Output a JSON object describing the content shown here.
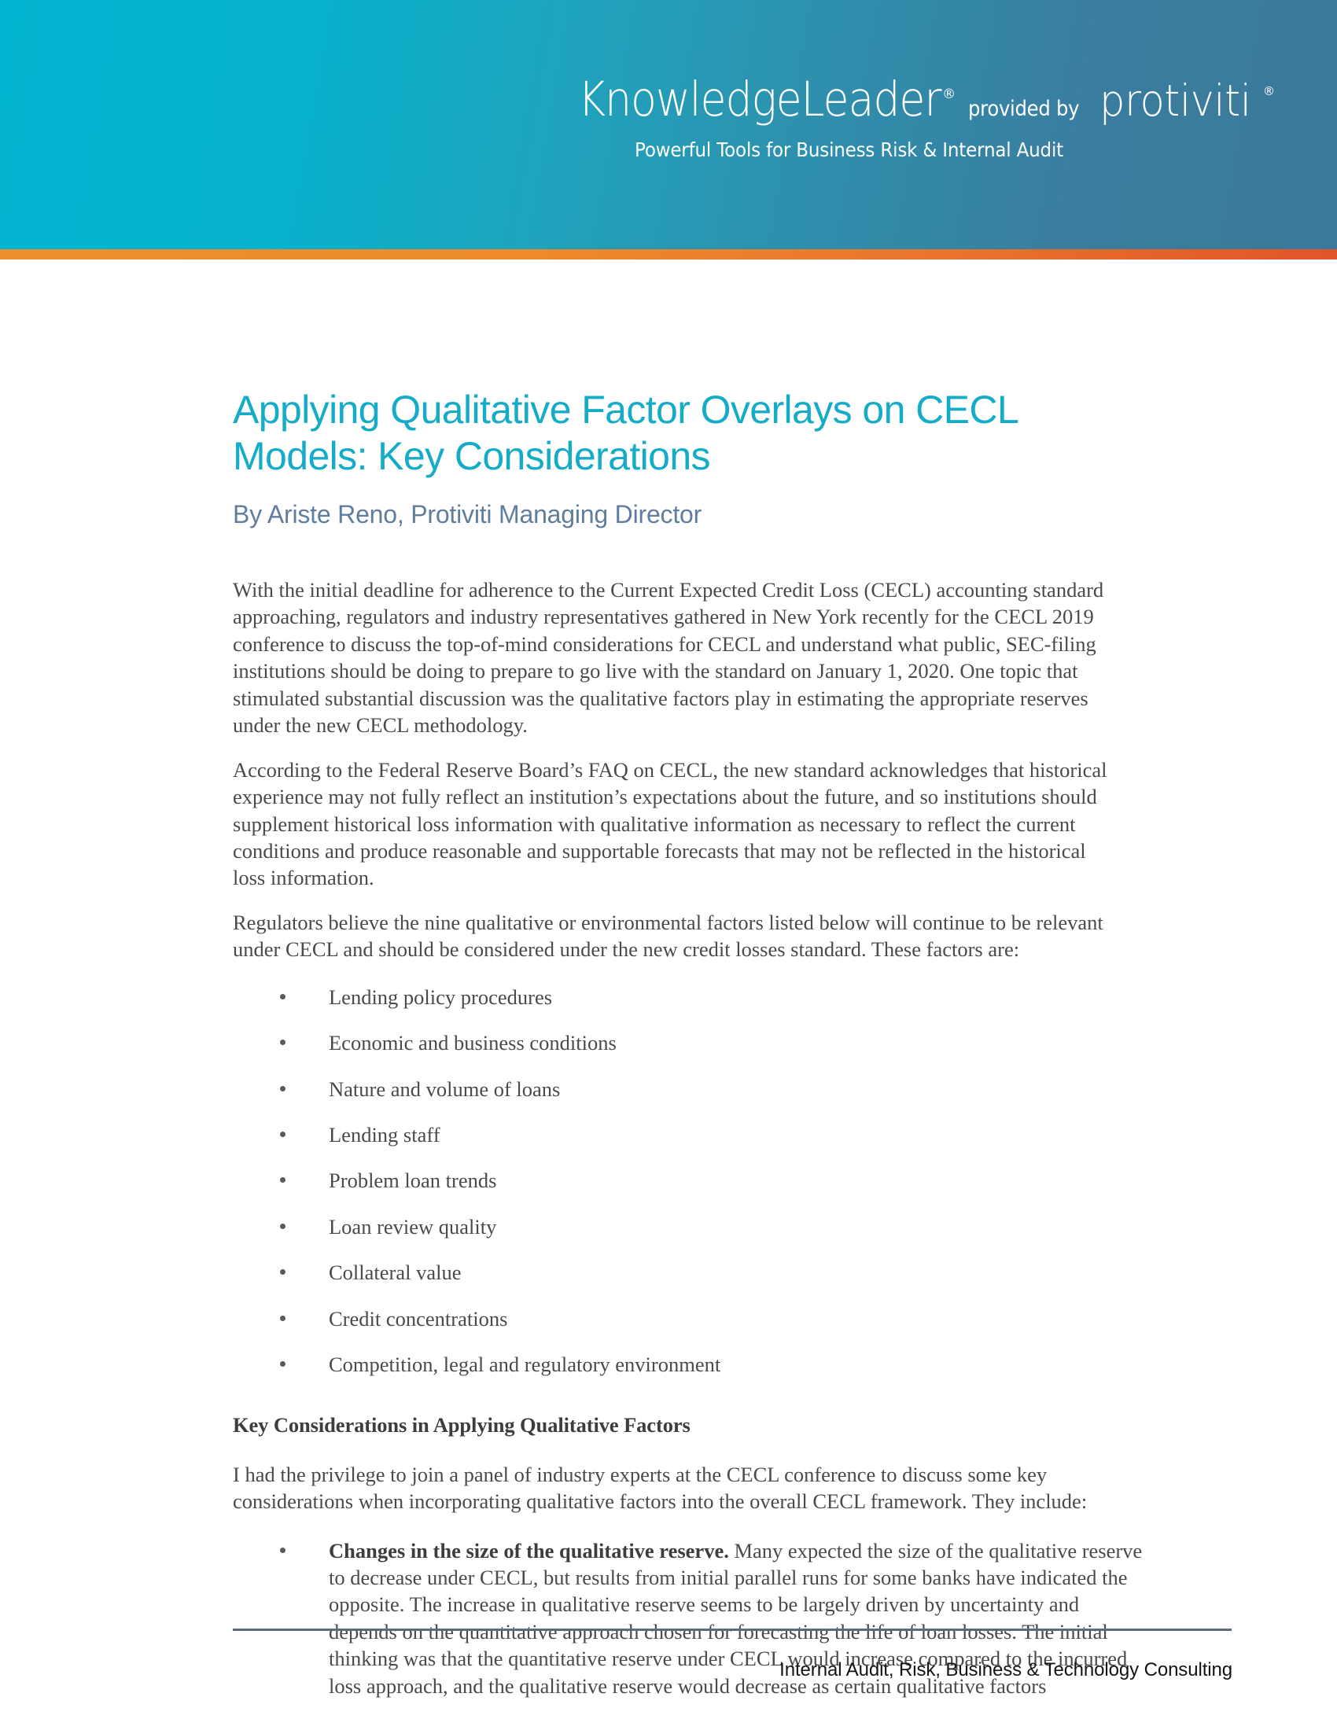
{
  "header": {
    "brand_primary": "KnowledgeLeader",
    "registered_mark": "®",
    "provided_by": "provided by",
    "brand_secondary": "protiviti",
    "tagline": "Powerful Tools for Business Risk & Internal Audit",
    "gradient_start": "#04b5d1",
    "gradient_end": "#3c7998",
    "accent_rule_start": "#ef8f2b",
    "accent_rule_end": "#e2542a"
  },
  "document": {
    "title": "Applying Qualitative Factor Overlays on CECL Models: Key Considerations",
    "title_color": "#15acc8",
    "byline": "By Ariste Reno, Protiviti Managing Director",
    "byline_color": "#5f7d9e",
    "paragraphs": [
      "With the initial deadline for adherence to the Current Expected Credit Loss (CECL) accounting standard approaching, regulators and industry representatives gathered in New York recently for the CECL 2019 conference to discuss the top-of-mind considerations for CECL and understand what public, SEC-filing institutions should be doing to prepare to go live with the standard on January 1, 2020. One topic that stimulated substantial discussion was the qualitative factors play in estimating the appropriate reserves under the new CECL methodology.",
      "According to the Federal Reserve Board’s FAQ on CECL, the new standard acknowledges that historical experience may not fully reflect an institution’s expectations about the future, and so institutions should supplement historical loss information with qualitative information as necessary to reflect the current conditions and produce reasonable and supportable forecasts that may not be reflected in the historical loss information.",
      "Regulators believe the nine qualitative or environmental factors listed below will continue to be relevant under CECL and should be considered under the new credit losses standard. These factors are:"
    ],
    "factors": [
      "Lending policy procedures",
      "Economic and business conditions",
      "Nature and volume of loans",
      "Lending staff",
      "Problem loan trends",
      "Loan review quality",
      "Collateral value",
      "Credit concentrations",
      "Competition, legal and regulatory environment"
    ],
    "section_heading": "Key Considerations in Applying Qualitative Factors",
    "section_intro": "I had the privilege to join a panel of industry experts at the CECL conference to discuss some key considerations when incorporating qualitative factors into the overall CECL framework. They include:",
    "key_considerations": [
      {
        "lead_in": "Changes in the size of the qualitative reserve.",
        "text": " Many expected the size of the qualitative reserve to decrease under CECL, but results from initial parallel runs for some banks have indicated the opposite. The increase in qualitative reserve seems to be largely driven by uncertainty and depends on the quantitative approach chosen for forecasting the life of loan losses. The initial thinking was that the quantitative reserve under CECL would increase compared to the incurred loss approach, and the qualitative reserve would decrease as certain qualitative factors"
      }
    ]
  },
  "footer": {
    "text": "Internal Audit, Risk, Business & Technology Consulting",
    "rule_color": "#5c6c7c"
  }
}
